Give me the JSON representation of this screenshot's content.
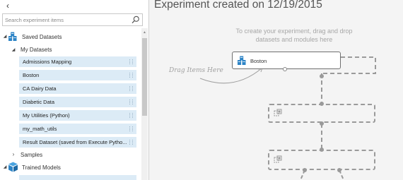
{
  "palette": {
    "collapse_icon": "chevron-left-icon",
    "collapse_glyph": "‹",
    "search": {
      "placeholder": "Search experiment items",
      "value": ""
    },
    "saved_datasets": {
      "label": "Saved Datasets",
      "my_datasets": {
        "label": "My Datasets",
        "items": [
          "Admissions Mapping",
          "Boston",
          "CA Dairy Data",
          "Diabetic Data",
          "My Utilities (Python)",
          "my_math_utils",
          "Result Dataset (saved from Execute Pytho..."
        ]
      },
      "samples": {
        "label": "Samples"
      }
    },
    "trained_models": {
      "label": "Trained Models"
    }
  },
  "canvas": {
    "title": "Experiment created on 12/19/2015",
    "hint": "To create your experiment, drag and drop datasets and modules here",
    "drag_label": "Drag Items Here",
    "node": {
      "label": "Boston"
    }
  },
  "colors": {
    "item_bg": "#dcebf6",
    "dataset_icon": "#2d84c6",
    "canvas_bg": "#f4f4f4",
    "dashed": "#9a9a9a"
  }
}
